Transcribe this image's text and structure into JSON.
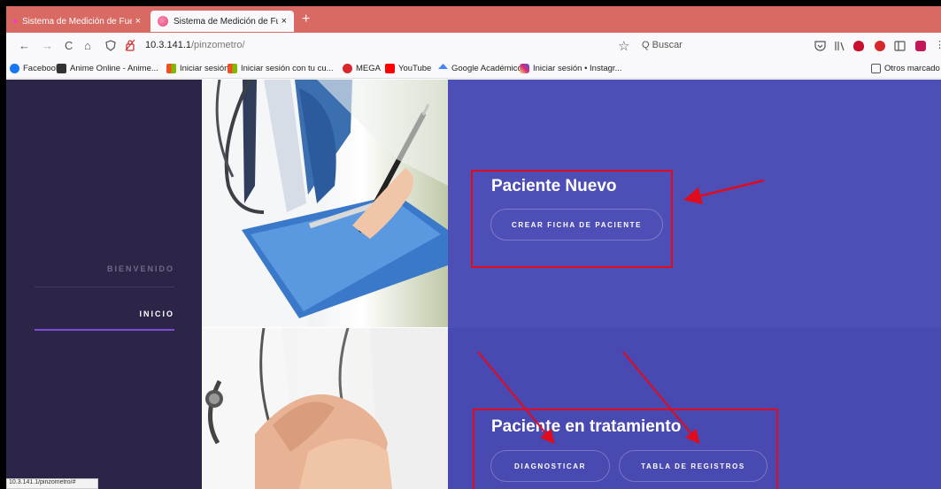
{
  "browser": {
    "tabs": [
      {
        "title": "Sistema de Medición de Fuerza",
        "close": "×",
        "active": false
      },
      {
        "title": "Sistema de Medición de Fuerza",
        "close": "×",
        "active": true
      }
    ],
    "new_tab": "+",
    "nav": {
      "back": "←",
      "forward": "→",
      "reload": "C",
      "home": "⌂"
    },
    "url_host": "10.3.141.1",
    "url_path": "/pinzometro/",
    "bookmark_star": "☆",
    "search_placeholder": "Q  Buscar",
    "bookmarks": [
      {
        "label": "Facebook",
        "color": "#1877f2"
      },
      {
        "label": "Anime Online - Anime...",
        "color": "#333333"
      },
      {
        "label": "Iniciar sesión",
        "color": "#f25022"
      },
      {
        "label": "Iniciar sesión con tu cu...",
        "color": "#f25022"
      },
      {
        "label": "MEGA",
        "color": "#d9272e"
      },
      {
        "label": "YouTube",
        "color": "#ff0000"
      },
      {
        "label": "Google Académico",
        "color": "#4285f4"
      },
      {
        "label": "Iniciar sesión • Instagr...",
        "color": "#d6249f"
      }
    ],
    "other_bookmarks": "Otros marcado",
    "status_url": "10.3.141.1/pinzometro/#"
  },
  "sidebar": {
    "welcome": "BIENVENIDO",
    "home": "INICIO"
  },
  "new_patient": {
    "title": "Paciente Nuevo",
    "button": "CREAR FICHA DE PACIENTE"
  },
  "treatment": {
    "title": "Paciente en tratamiento",
    "diagnose_button": "DIAGNOSTICAR",
    "records_button": "TABLA DE REGISTROS"
  },
  "colors": {
    "tab_bar": "#d96a63",
    "sidebar": "#2c2547",
    "panel": "#4d4fb7",
    "highlight": "#e00b1c",
    "active_indicator": "#7d4cd8"
  }
}
